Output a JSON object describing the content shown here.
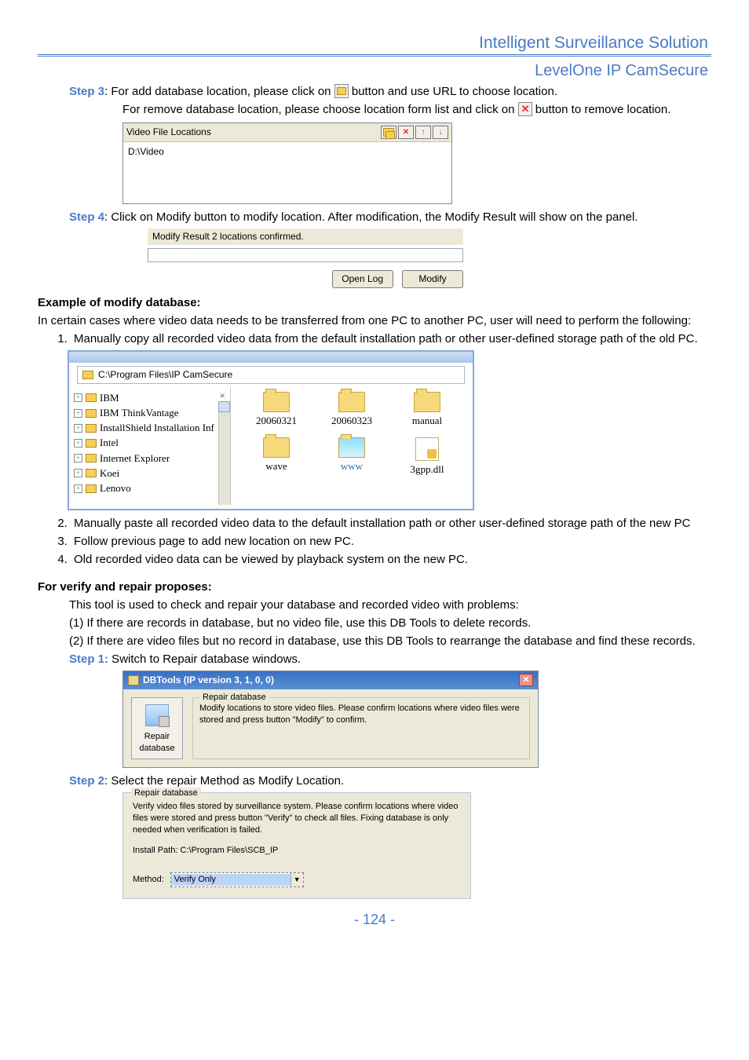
{
  "header": {
    "line1": "Intelligent Surveillance Solution",
    "line2": "LevelOne IP CamSecure"
  },
  "step3": {
    "label": "Step 3",
    "text_a": ": For add database location, please click on ",
    "text_b": "button and use URL to choose location.",
    "text_c": "For remove database location, please choose location form list and click on ",
    "text_d": "button to remove location."
  },
  "vfl": {
    "header": "Video File Locations",
    "item": "D:\\Video"
  },
  "step4": {
    "label": "Step 4",
    "text_a": ":  Click on Modify button to modify location. After modification, the Modify Result will show on the panel."
  },
  "modify_result": {
    "label": "Modify Result   2 locations confirmed.",
    "open_log": "Open Log",
    "modify": "Modify"
  },
  "example_heading": "Example of modify database:",
  "example_intro": "In certain cases where video data needs to be transferred from one PC to another PC, user will need to perform the following:",
  "numlist": [
    "Manually copy all recorded video data from the default installation path or other user-defined storage path of the old PC.",
    "Manually paste all recorded video data to the default installation path or other user-defined storage path of the new PC",
    "Follow previous page to add new location on new PC.",
    "Old recorded video data can be viewed by playback system on the new PC."
  ],
  "explorer": {
    "address": "C:\\Program Files\\IP CamSecure",
    "tree": [
      "IBM",
      "IBM ThinkVantage",
      "InstallShield Installation Inf",
      "Intel",
      "Internet Explorer",
      "Koei",
      "Lenovo"
    ],
    "files": [
      {
        "name": "20060321",
        "type": "folder"
      },
      {
        "name": "20060323",
        "type": "folder"
      },
      {
        "name": "manual",
        "type": "folder"
      },
      {
        "name": "wave",
        "type": "folder"
      },
      {
        "name": "www",
        "type": "folder-open"
      },
      {
        "name": "3gpp.dll",
        "type": "dll"
      }
    ]
  },
  "verify_heading": "For verify and repair proposes:",
  "verify_intro": "This tool is used to check and repair your database and recorded video with problems:",
  "verify_1": "(1) If there are records in database, but no video file, use this DB Tools to delete records.",
  "verify_2": "(2) If there are video files but no record in database, use this DB Tools to rearrange the database and find these records.",
  "verify_step1": {
    "label": "Step 1:",
    "text": " Switch to Repair database windows."
  },
  "dbtools": {
    "title": "DBTools (IP version 3, 1, 0, 0)",
    "side_label1": "Repair",
    "side_label2": "database",
    "legend": "Repair database",
    "body": "Modify locations to store video files. Please confirm locations where video files were stored and press button \"Modify\" to confirm."
  },
  "verify_step2": {
    "label": "Step 2",
    "text": ": Select the repair Method as Modify Location."
  },
  "repair2": {
    "legend": "Repair database",
    "line1": "Verify video files stored by surveillance system. Please confirm locations where video files were stored and press button \"Verify\" to check all files. Fixing database is only needed when verification is failed.",
    "install": "Install Path: C:\\Program Files\\SCB_IP",
    "method_label": "Method:",
    "method_value": "Verify Only"
  },
  "page_number": "- 124 -"
}
